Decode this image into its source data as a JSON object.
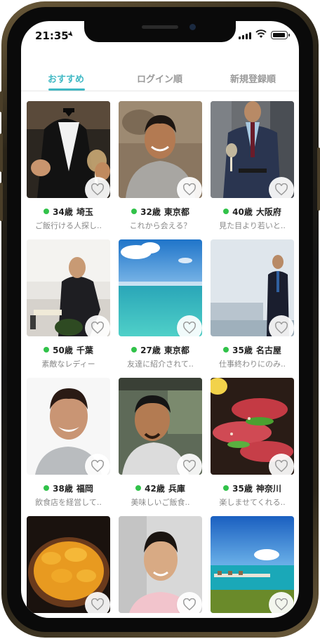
{
  "status_bar": {
    "time": "21:35"
  },
  "tabs": [
    {
      "label": "おすすめ",
      "active": true
    },
    {
      "label": "ログイン順",
      "active": false
    },
    {
      "label": "新規登録順",
      "active": false
    }
  ],
  "colors": {
    "accent": "#3fb8c4",
    "online": "#31c24a"
  },
  "profiles": [
    {
      "age": "34歳",
      "location": "埼玉",
      "bio": "ご飯行ける人探し..",
      "photo": "man-in-tuxedo-with-wine-glass"
    },
    {
      "age": "32歳",
      "location": "東京都",
      "bio": "これから会える？",
      "photo": "smiling-man-gray-sweater"
    },
    {
      "age": "40歳",
      "location": "大阪府",
      "bio": "見た目より若いと..",
      "photo": "man-in-suit-with-wine"
    },
    {
      "age": "50歳",
      "location": "千葉",
      "bio": "素敵なレディー",
      "photo": "businessman-at-desk-on-phone"
    },
    {
      "age": "27歳",
      "location": "東京都",
      "bio": "友達に紹介されて..",
      "photo": "tropical-beach-sky"
    },
    {
      "age": "35歳",
      "location": "名古屋",
      "bio": "仕事終わりにのみ..",
      "photo": "man-in-suit-waterfront"
    },
    {
      "age": "38歳",
      "location": "福岡",
      "bio": "飲食店を経営して..",
      "photo": "smiling-man-portrait"
    },
    {
      "age": "42歳",
      "location": "兵庫",
      "bio": "美味しいご飯食..",
      "photo": "man-selfie-restaurant"
    },
    {
      "age": "35歳",
      "location": "神奈川",
      "bio": "楽しませてくれる..",
      "photo": "grilled-beef-platter"
    },
    {
      "age": "",
      "location": "",
      "bio": "",
      "photo": "sea-urchin-rice-bowl"
    },
    {
      "age": "",
      "location": "",
      "bio": "",
      "photo": "smiling-young-man"
    },
    {
      "age": "",
      "location": "",
      "bio": "",
      "photo": "island-resort-ocean"
    }
  ]
}
